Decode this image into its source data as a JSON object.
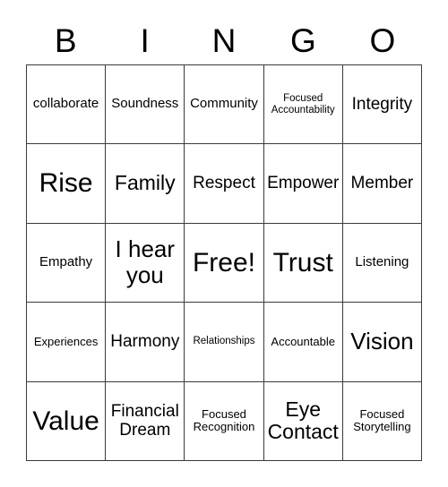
{
  "card": {
    "title": "BINGO",
    "header_letters": [
      "B",
      "I",
      "N",
      "G",
      "O"
    ],
    "border_color": "#3a3a3a",
    "background_color": "#ffffff",
    "text_color": "#000000",
    "rows": [
      [
        {
          "text": "collaborate",
          "size": "md"
        },
        {
          "text": "Soundness",
          "size": "md"
        },
        {
          "text": "Community",
          "size": "md"
        },
        {
          "text": "Focused Accountability",
          "size": "xs"
        },
        {
          "text": "Integrity",
          "size": "lg"
        }
      ],
      [
        {
          "text": "Rise",
          "size": "huge"
        },
        {
          "text": "Family",
          "size": "xl"
        },
        {
          "text": "Respect",
          "size": "lg"
        },
        {
          "text": "Empower",
          "size": "lg"
        },
        {
          "text": "Member",
          "size": "lg"
        }
      ],
      [
        {
          "text": "Empathy",
          "size": "md"
        },
        {
          "text": "I hear you",
          "size": "xxl"
        },
        {
          "text": "Free!",
          "size": "huge"
        },
        {
          "text": "Trust",
          "size": "huge"
        },
        {
          "text": "Listening",
          "size": "md"
        }
      ],
      [
        {
          "text": "Experiences",
          "size": "sm"
        },
        {
          "text": "Harmony",
          "size": "lg"
        },
        {
          "text": "Relationships",
          "size": "xs"
        },
        {
          "text": "Accountable",
          "size": "sm"
        },
        {
          "text": "Vision",
          "size": "xxl"
        }
      ],
      [
        {
          "text": "Value",
          "size": "huge"
        },
        {
          "text": "Financial Dream",
          "size": "lg"
        },
        {
          "text": "Focused Recognition",
          "size": "sm"
        },
        {
          "text": "Eye Contact",
          "size": "xl"
        },
        {
          "text": "Focused Storytelling",
          "size": "sm"
        }
      ]
    ]
  }
}
